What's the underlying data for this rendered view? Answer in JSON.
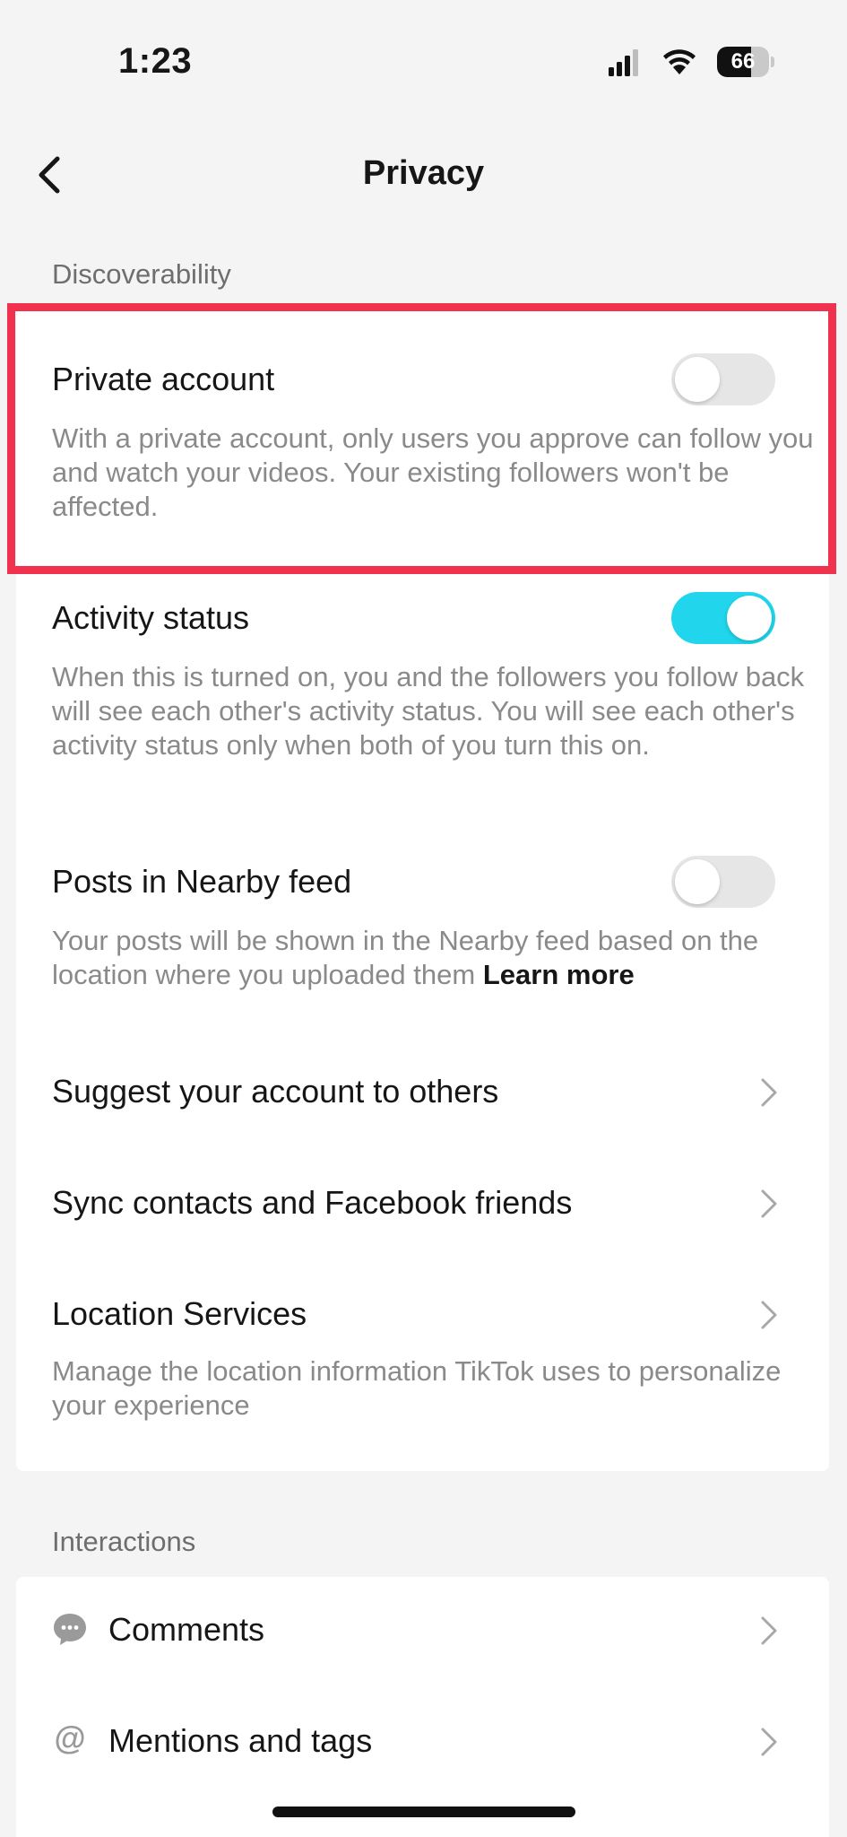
{
  "status_bar": {
    "time": "1:23",
    "battery_level": "66",
    "battery_fraction": 0.66
  },
  "nav": {
    "title": "Privacy"
  },
  "sections": {
    "discoverability": {
      "header": "Discoverability",
      "items": [
        {
          "title": "Private account",
          "description": "With a private account, only users you approve can follow you and watch your videos. Your existing followers won't be affected.",
          "toggle": "off"
        },
        {
          "title": "Activity status",
          "description": "When this is turned on, you and the followers you follow back will see each other's activity status. You will see each other's activity status only when both of you turn this on.",
          "toggle": "on"
        },
        {
          "title": "Posts in Nearby feed",
          "description": "Your posts will be shown in the Nearby feed based on the location where you uploaded them",
          "link": "Learn more",
          "toggle": "off"
        },
        {
          "title": "Suggest your account to others"
        },
        {
          "title": "Sync contacts and Facebook friends"
        },
        {
          "title": "Location Services",
          "description": "Manage the location information TikTok uses to personalize your experience"
        }
      ]
    },
    "interactions": {
      "header": "Interactions",
      "items": [
        {
          "title": "Comments",
          "icon": "comment-bubble-icon"
        },
        {
          "title": "Mentions and tags",
          "icon": "at-sign-icon"
        }
      ]
    }
  },
  "colors": {
    "toggle_on": "#20d5ec",
    "toggle_off": "#e6e6e6",
    "highlight": "#f0324e",
    "background": "#f4f4f4"
  }
}
